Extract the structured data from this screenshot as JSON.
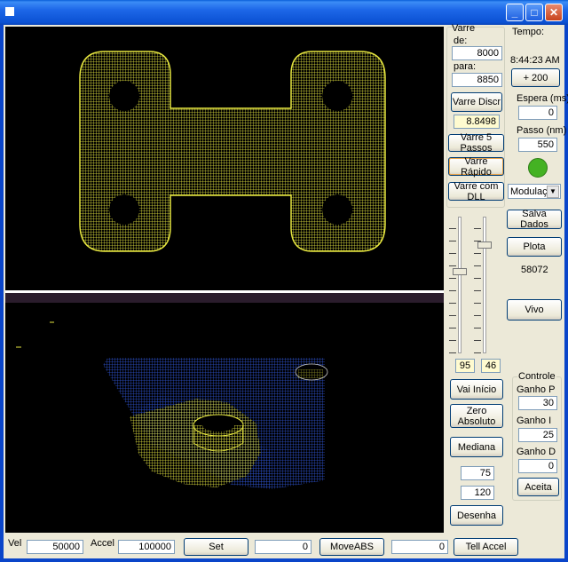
{
  "window": {
    "minimize_glyph": "_",
    "maximize_glyph": "□",
    "close_glyph": "✕"
  },
  "scan": {
    "group_label": "Varre",
    "from_label": "de:",
    "from_value": "8000",
    "to_label": "para:",
    "to_value": "8850",
    "discrete_button": "Varre Discr",
    "current_value": "8.8498",
    "five_steps_button": "Varre 5 Passos",
    "fast_button": "Varre Rápido",
    "dll_button": "Varre com DLL"
  },
  "time": {
    "label": "Tempo:",
    "value": "8:44:23 AM",
    "plus_button": "+ 200",
    "wait_label": "Espera (ms)",
    "wait_value": "0",
    "step_label": "Passo (nm)",
    "step_value": "550",
    "modulation_selected": "Modulação"
  },
  "data": {
    "save_button": "Salva Dados",
    "plot_button": "Plota",
    "count_value": "58072",
    "live_button": "Vivo"
  },
  "sliders": {
    "left_value": "95",
    "right_value": "46"
  },
  "motion": {
    "start_button": "Vai Início",
    "zero_button": "Zero Absoluto",
    "median_button": "Mediana",
    "field_a": "75",
    "field_b": "120",
    "draw_button": "Desenha"
  },
  "controller": {
    "group_label": "Controle",
    "p_label": "Ganho P",
    "p_value": "30",
    "i_label": "Ganho I",
    "i_value": "25",
    "d_label": "Ganho D",
    "d_value": "0",
    "accept_button": "Aceita"
  },
  "bottom": {
    "vel_label": "Vel",
    "vel_value": "50000",
    "accel_label": "Accel",
    "accel_value": "100000",
    "set_button": "Set",
    "pos_value": "0",
    "move_button": "MoveABS",
    "pos2_value": "0",
    "tell_button": "Tell Accel"
  },
  "colors": {
    "wire_yellow": "#e6e640",
    "wire_blue": "#2f56d8",
    "status_green": "#44b223"
  }
}
